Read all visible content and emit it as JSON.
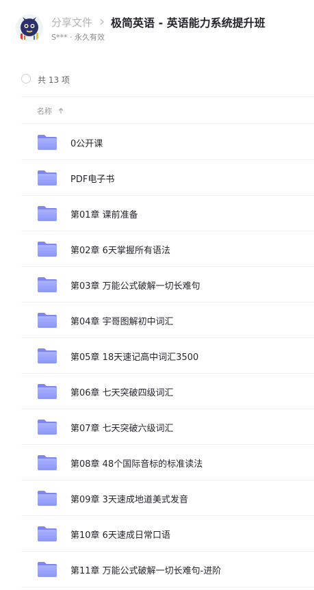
{
  "header": {
    "breadcrumb_root": "分享文件",
    "title": "极简英语 - 英语能力系统提升班",
    "share_meta": "S*** · 永久有效"
  },
  "summary": {
    "count_label": "共 13 项"
  },
  "columns": {
    "name_label": "名称"
  },
  "files": [
    {
      "name": "0公开课",
      "icon": "folder-icon"
    },
    {
      "name": "PDF电子书",
      "icon": "folder-icon"
    },
    {
      "name": "第01章 课前准备",
      "icon": "folder-icon"
    },
    {
      "name": "第02章 6天掌握所有语法",
      "icon": "folder-icon"
    },
    {
      "name": "第03章 万能公式破解一切长难句",
      "icon": "folder-icon"
    },
    {
      "name": "第04章 宇哥图解初中词汇",
      "icon": "folder-icon"
    },
    {
      "name": "第05章 18天速记高中词汇3500",
      "icon": "folder-icon"
    },
    {
      "name": "第06章 七天突破四级词汇",
      "icon": "folder-icon"
    },
    {
      "name": "第07章 七天突破六级词汇",
      "icon": "folder-icon"
    },
    {
      "name": "第08章 48个国际音标的标准读法",
      "icon": "folder-icon"
    },
    {
      "name": "第09章 3天速成地道美式发音",
      "icon": "folder-icon"
    },
    {
      "name": "第10章 6天速成日常口语",
      "icon": "folder-icon"
    },
    {
      "name": "第11章 万能公式破解一切长难句-进阶",
      "icon": "folder-icon"
    }
  ],
  "colors": {
    "folder_light": "#a9b1ff",
    "folder_dark": "#7c87f6",
    "text": "#25262b",
    "muted": "#b3b3b3"
  }
}
